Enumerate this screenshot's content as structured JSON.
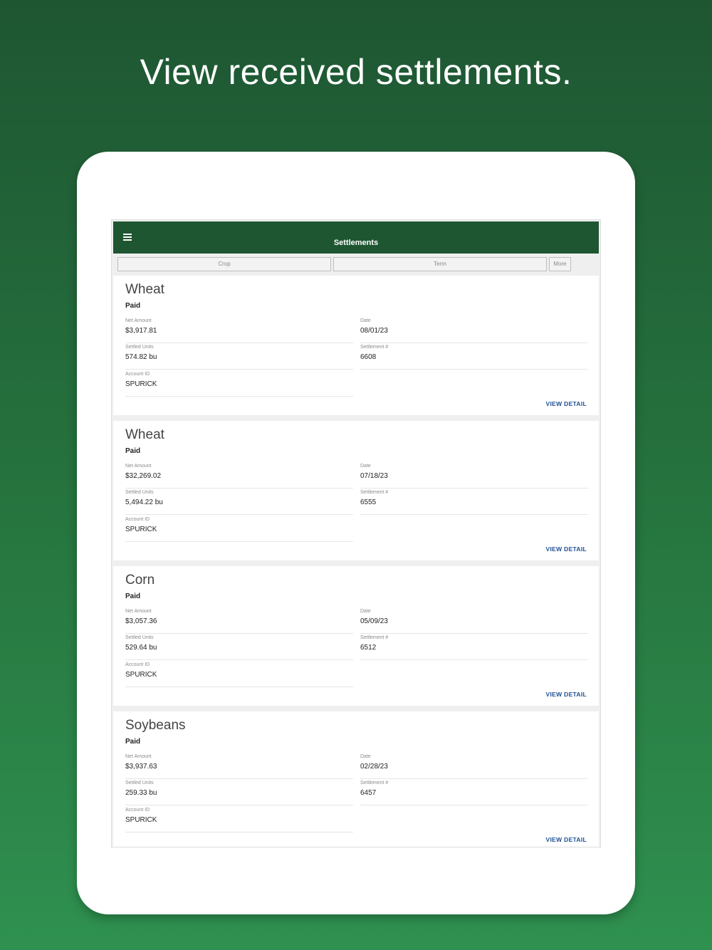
{
  "promo": {
    "headline": "View received settlements."
  },
  "appbar": {
    "title": "Settlements"
  },
  "filters": {
    "crop": "Crop",
    "term": "Term",
    "more": "More"
  },
  "labels": {
    "net_amount": "Net Amount",
    "date": "Date",
    "settled_units": "Settled Units",
    "settlement_no": "Settlement #",
    "account_id": "Account ID",
    "view_detail": "VIEW DETAIL"
  },
  "settlements": [
    {
      "crop": "Wheat",
      "status": "Paid",
      "net_amount": "$3,917.81",
      "date": "08/01/23",
      "settled_units": "574.82 bu",
      "settlement_no": "6608",
      "account_id": "SPURICK"
    },
    {
      "crop": "Wheat",
      "status": "Paid",
      "net_amount": "$32,269.02",
      "date": "07/18/23",
      "settled_units": "5,494.22 bu",
      "settlement_no": "6555",
      "account_id": "SPURICK"
    },
    {
      "crop": "Corn",
      "status": "Paid",
      "net_amount": "$3,057.36",
      "date": "05/09/23",
      "settled_units": "529.64 bu",
      "settlement_no": "6512",
      "account_id": "SPURICK"
    },
    {
      "crop": "Soybeans",
      "status": "Paid",
      "net_amount": "$3,937.63",
      "date": "02/28/23",
      "settled_units": "259.33 bu",
      "settlement_no": "6457",
      "account_id": "SPURICK"
    }
  ]
}
